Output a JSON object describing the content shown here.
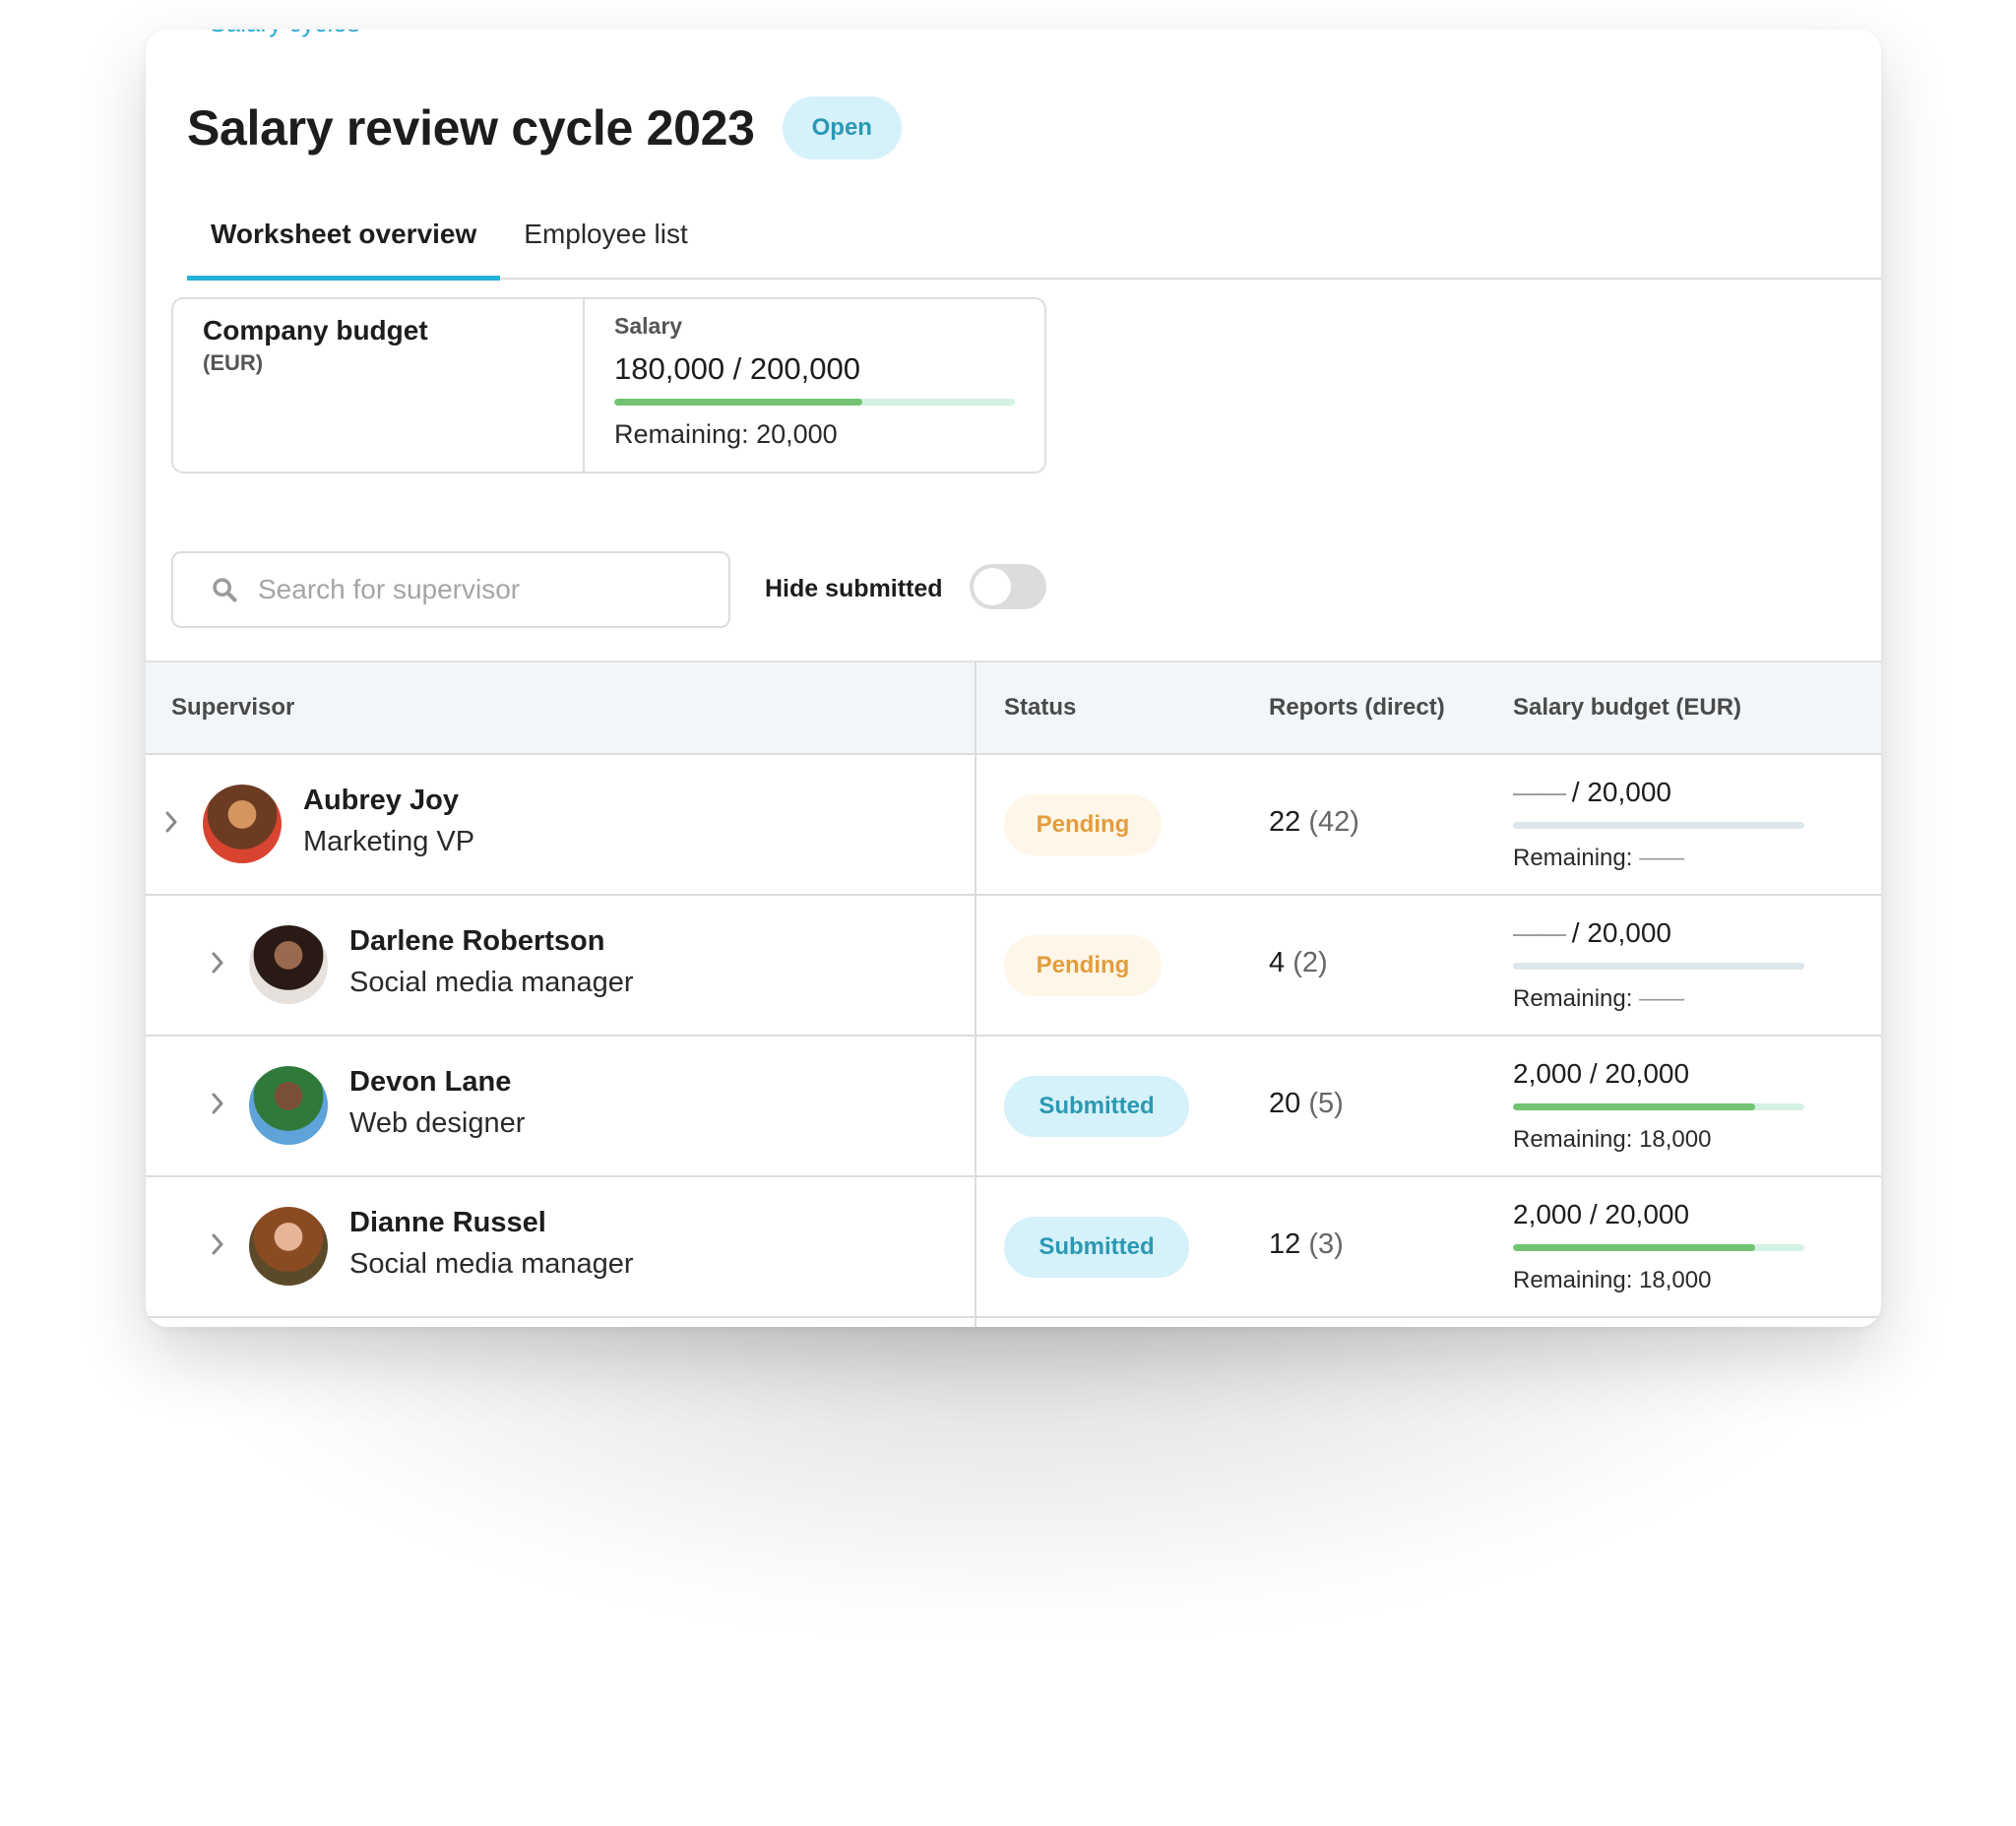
{
  "breadcrumb": "< Salary cycles",
  "header": {
    "title": "Salary review cycle 2023",
    "status_badge": "Open"
  },
  "tabs": [
    {
      "label": "Worksheet overview",
      "active": true
    },
    {
      "label": "Employee list",
      "active": false
    }
  ],
  "company_budget": {
    "title": "Company budget",
    "currency": "(EUR)",
    "salary_label": "Salary",
    "value": "180,000 / 200,000",
    "progress_fraction": 0.62,
    "remaining": "Remaining: 20,000"
  },
  "filters": {
    "search_placeholder": "Search for supervisor",
    "search_value": "",
    "hide_submitted_label": "Hide submitted",
    "hide_submitted_on": false
  },
  "table": {
    "columns": [
      "Supervisor",
      "Status",
      "Reports (direct)",
      "Salary budget (EUR)"
    ],
    "rows": [
      {
        "name": "Aubrey Joy",
        "role": "Marketing VP",
        "level": 0,
        "status": "Pending",
        "reports": "22",
        "direct": "(42)",
        "budget_used": "——",
        "budget_total": " / 20,000",
        "budget_fraction": 0,
        "remaining_label": "Remaining: ",
        "remaining_value": "——",
        "avatar_colors": [
          "#6b3b22",
          "#d6955f",
          "#d8442f"
        ]
      },
      {
        "name": "Darlene Robertson",
        "role": "Social media manager",
        "level": 1,
        "status": "Pending",
        "reports": "4",
        "direct": "(2)",
        "budget_used": "——",
        "budget_total": " / 20,000",
        "budget_fraction": 0,
        "remaining_label": "Remaining: ",
        "remaining_value": "——",
        "avatar_colors": [
          "#2a1a15",
          "#9a6a4f",
          "#e6e1dc"
        ]
      },
      {
        "name": "Devon Lane",
        "role": "Web designer",
        "level": 1,
        "status": "Submitted",
        "reports": "20",
        "direct": "(5)",
        "budget_used": "2,000",
        "budget_total": " / 20,000",
        "budget_fraction": 0.83,
        "remaining_label": "Remaining: ",
        "remaining_value": "18,000",
        "avatar_colors": [
          "#2f7a3a",
          "#7b5036",
          "#5ea3d9"
        ]
      },
      {
        "name": "Dianne Russel",
        "role": "Social media manager",
        "level": 1,
        "status": "Submitted",
        "reports": "12",
        "direct": "(3)",
        "budget_used": "2,000",
        "budget_total": " / 20,000",
        "budget_fraction": 0.83,
        "remaining_label": "Remaining: ",
        "remaining_value": "18,000",
        "avatar_colors": [
          "#8a4a22",
          "#e6b497",
          "#5b4a2a"
        ]
      }
    ]
  },
  "colors": {
    "accent": "#25b2d8",
    "progress_fill": "#72c472",
    "progress_track": "#d4f2e3",
    "pending_text": "#e39d3b",
    "submitted_text": "#2b98b3"
  }
}
